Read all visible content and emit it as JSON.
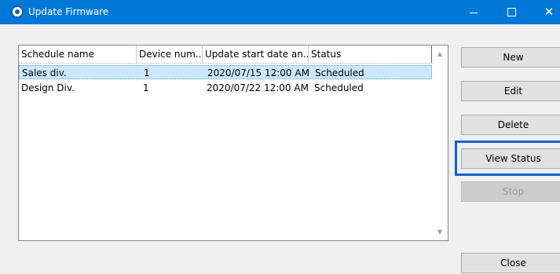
{
  "window": {
    "title": "Update Firmware",
    "caption": {
      "minimize": "—",
      "maximize": "☐",
      "close": "✕"
    }
  },
  "list": {
    "columns": [
      "Schedule name",
      "Device num...",
      "Update start date an...",
      "Status"
    ],
    "rows": [
      {
        "name": "Sales div.",
        "devices": "1",
        "start": "2020/07/15 12:00 AM",
        "status": "Scheduled",
        "selected": true
      },
      {
        "name": "Design Div.",
        "devices": "1",
        "start": "2020/07/22 12:00 AM",
        "status": "Scheduled",
        "selected": false
      }
    ]
  },
  "buttons": {
    "new": "New",
    "edit": "Edit",
    "delete": "Delete",
    "view_status": "View Status",
    "stop": "Stop",
    "close": "Close"
  },
  "colors": {
    "titlebar": "#0078d7",
    "selection": "#cce8ff",
    "highlight_box": "#1a5fd6"
  }
}
